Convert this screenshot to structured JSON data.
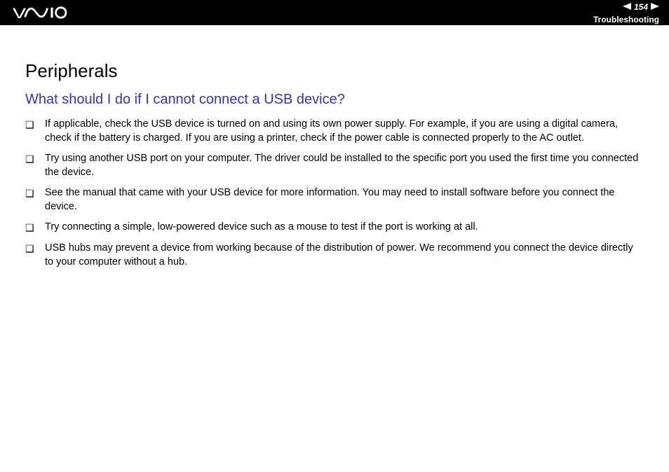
{
  "header": {
    "page_number": "154",
    "section": "Troubleshooting"
  },
  "content": {
    "title": "Peripherals",
    "question": "What should I do if I cannot connect a USB device?",
    "bullets": [
      "If applicable, check the USB device is turned on and using its own power supply. For example, if you are using a digital camera, check if the battery is charged. If you are using a printer, check if the power cable is connected properly to the AC outlet.",
      "Try using another USB port on your computer. The driver could be installed to the specific port you used the first time you connected the device.",
      "See the manual that came with your USB device for more information. You may need to install software before you connect the device.",
      "Try connecting a simple, low-powered device such as a mouse to test if the port is working at all.",
      "USB hubs may prevent a device from working because of the distribution of power. We recommend you connect the device directly to your computer without a hub."
    ]
  }
}
